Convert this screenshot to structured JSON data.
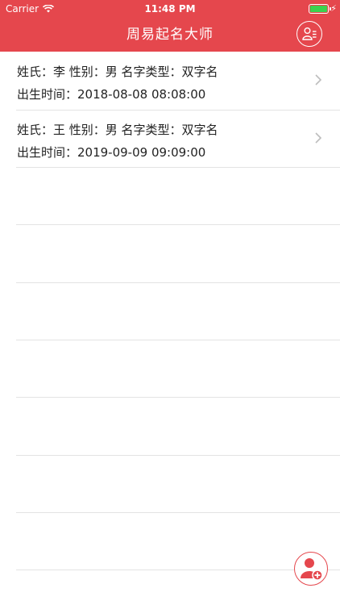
{
  "status_bar": {
    "carrier": "Carrier",
    "time": "11:48 PM",
    "battery_level": 1.0
  },
  "nav": {
    "title": "周易起名大师"
  },
  "records": [
    {
      "summary": "姓氏：李 性别：男 名字类型：双字名",
      "birth": "出生时间：2018-08-08 08:08:00"
    },
    {
      "summary": "姓氏：王 性别：男 名字类型：双字名",
      "birth": "出生时间：2019-09-09 09:09:00"
    }
  ],
  "icons": {
    "profile": "user-list-icon",
    "add": "add-user-icon",
    "row_disclosure": "chevron-right-icon"
  },
  "colors": {
    "accent": "#e5474d",
    "battery": "#3cd14e"
  }
}
